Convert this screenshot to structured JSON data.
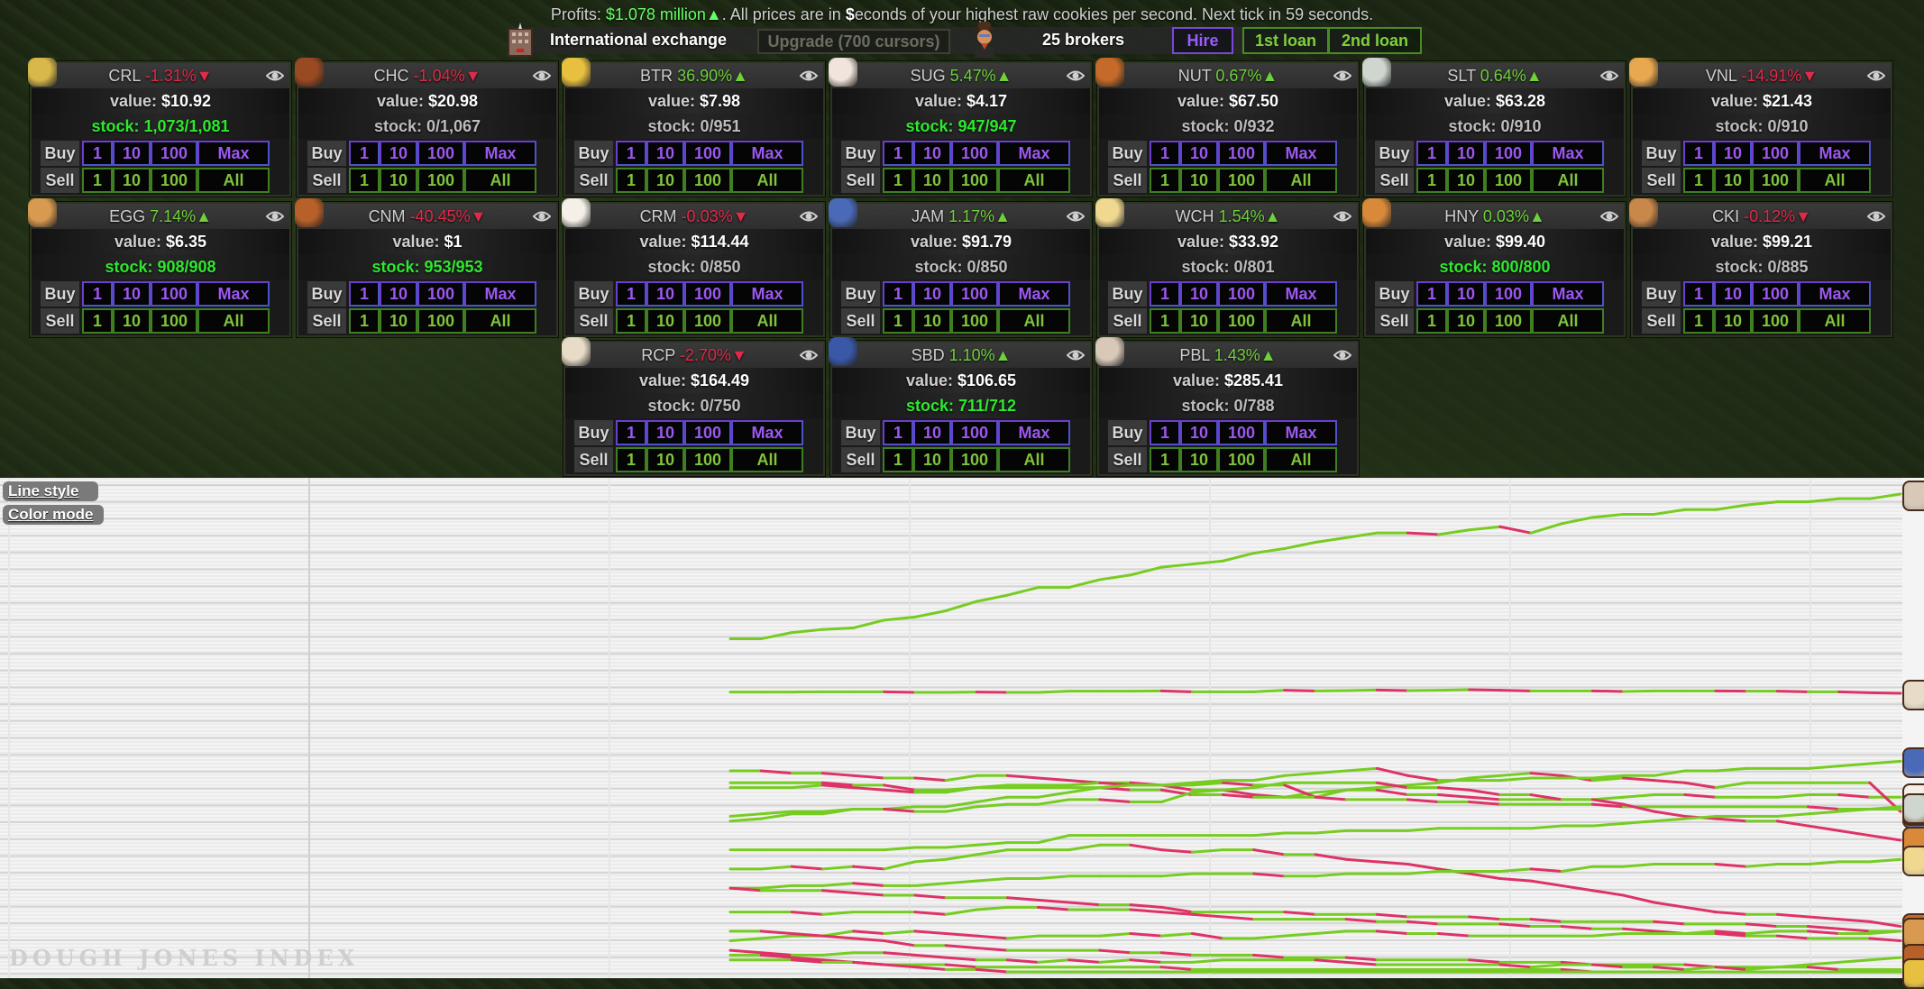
{
  "header": {
    "profits_prefix": "Profits: ",
    "profits_value": "$1.078 million▲",
    "profits_suffix_1": ". All prices are in ",
    "dollar_sign": "$",
    "profits_suffix_2": "econds of your highest raw cookies per second. Next tick in 59 seconds.",
    "exchange_name": "International exchange",
    "upgrade_label": "Upgrade (700 cursors)",
    "brokers_label": "25 brokers",
    "hire_label": "Hire",
    "loan1_label": "1st loan",
    "loan2_label": "2nd loan",
    "icons": {
      "exchange": "office-building-icon",
      "broker": "broker-icon"
    }
  },
  "labels": {
    "value_prefix": "value: ",
    "stock_prefix": "stock: ",
    "buy": "Buy",
    "sell": "Sell",
    "q1": "1",
    "q10": "10",
    "q100": "100",
    "max": "Max",
    "all": "All"
  },
  "goods": [
    {
      "symbol": "CRL",
      "change": "-1.31%▼",
      "dir": "down",
      "value": "$10.92",
      "stock": "1,073/1,081",
      "full": true,
      "icon": "cereals-icon",
      "color": "#d8b84a"
    },
    {
      "symbol": "CHC",
      "change": "-1.04%▼",
      "dir": "down",
      "value": "$20.98",
      "stock": "0/1,067",
      "full": false,
      "icon": "chocolate-icon",
      "color": "#9a4a22"
    },
    {
      "symbol": "BTR",
      "change": "36.90%▲",
      "dir": "up",
      "value": "$7.98",
      "stock": "0/951",
      "full": false,
      "icon": "butter-icon",
      "color": "#e8c040"
    },
    {
      "symbol": "SUG",
      "change": "5.47%▲",
      "dir": "up",
      "value": "$4.17",
      "stock": "947/947",
      "full": true,
      "icon": "sugar-icon",
      "color": "#f0e4dc"
    },
    {
      "symbol": "NUT",
      "change": "0.67%▲",
      "dir": "up",
      "value": "$67.50",
      "stock": "0/932",
      "full": false,
      "icon": "nuts-icon",
      "color": "#c46a2a"
    },
    {
      "symbol": "SLT",
      "change": "0.64%▲",
      "dir": "up",
      "value": "$63.28",
      "stock": "0/910",
      "full": false,
      "icon": "salt-icon",
      "color": "#cfd6cf"
    },
    {
      "symbol": "VNL",
      "change": "-14.91%▼",
      "dir": "down",
      "value": "$21.43",
      "stock": "0/910",
      "full": false,
      "icon": "vanilla-icon",
      "color": "#e8a850"
    },
    {
      "symbol": "EGG",
      "change": "7.14%▲",
      "dir": "up",
      "value": "$6.35",
      "stock": "908/908",
      "full": true,
      "icon": "eggs-icon",
      "color": "#d89a50"
    },
    {
      "symbol": "CNM",
      "change": "-40.45%▼",
      "dir": "down",
      "value": "$1",
      "stock": "953/953",
      "full": true,
      "icon": "cinnamon-icon",
      "color": "#b8602a"
    },
    {
      "symbol": "CRM",
      "change": "-0.03%▼",
      "dir": "down",
      "value": "$114.44",
      "stock": "0/850",
      "full": false,
      "icon": "cream-icon",
      "color": "#f4f0e8"
    },
    {
      "symbol": "JAM",
      "change": "1.17%▲",
      "dir": "up",
      "value": "$91.79",
      "stock": "0/850",
      "full": false,
      "icon": "jam-icon",
      "color": "#4a6ab8"
    },
    {
      "symbol": "WCH",
      "change": "1.54%▲",
      "dir": "up",
      "value": "$33.92",
      "stock": "0/801",
      "full": false,
      "icon": "white-chocolate-icon",
      "color": "#f0d890"
    },
    {
      "symbol": "HNY",
      "change": "0.03%▲",
      "dir": "up",
      "value": "$99.40",
      "stock": "800/800",
      "full": true,
      "icon": "honey-icon",
      "color": "#d88a3a"
    },
    {
      "symbol": "CKI",
      "change": "-0.12%▼",
      "dir": "down",
      "value": "$99.21",
      "stock": "0/885",
      "full": false,
      "icon": "cookies-icon",
      "color": "#c8884a"
    },
    {
      "symbol": "RCP",
      "change": "-2.70%▼",
      "dir": "down",
      "value": "$164.49",
      "stock": "0/750",
      "full": false,
      "icon": "recipes-icon",
      "color": "#e8dcc8"
    },
    {
      "symbol": "SBD",
      "change": "1.10%▲",
      "dir": "up",
      "value": "$106.65",
      "stock": "711/712",
      "full": true,
      "icon": "subsidiaries-icon",
      "color": "#3a58a8"
    },
    {
      "symbol": "PBL",
      "change": "1.43%▲",
      "dir": "up",
      "value": "$285.41",
      "stock": "0/788",
      "full": false,
      "icon": "public-relations-icon",
      "color": "#d8c8b8"
    }
  ],
  "chart_controls": {
    "line_style": "Line style",
    "color_mode": "Color mode"
  },
  "chart_data": {
    "type": "line",
    "title": "DOUGH JONES INDEX",
    "xlabel": "",
    "ylabel": "",
    "x_ticks": 27,
    "ylim": [
      0,
      300
    ],
    "grid": true,
    "legend": "icons at right end of each line",
    "up_color": "#77cc22",
    "down_color": "#dd3366",
    "series": [
      {
        "name": "PBL",
        "values": [
          232,
          232,
          236,
          238,
          239,
          244,
          246,
          250,
          256,
          260,
          265,
          265,
          270,
          273,
          278,
          280,
          282,
          287,
          290,
          294,
          297,
          300,
          300,
          299,
          302,
          304,
          300,
          306,
          310,
          312,
          312,
          315,
          315,
          318,
          320,
          320,
          322,
          322,
          325
        ]
      },
      {
        "name": "RCP",
        "values": [
          162,
          162,
          162,
          163,
          163,
          163,
          161,
          161,
          162,
          161,
          161,
          165,
          165,
          165,
          166,
          163,
          163,
          163,
          168,
          166,
          167,
          169,
          167,
          168,
          170,
          168,
          166,
          166,
          166,
          164,
          166,
          166,
          166,
          165,
          165,
          163,
          163,
          160,
          158
        ]
      },
      {
        "name": "CRM",
        "values": [
          125,
          125,
          124,
          124,
          123,
          122,
          122,
          121,
          123,
          123,
          122,
          121,
          120,
          120,
          119,
          117,
          117,
          115,
          114,
          116,
          117,
          117,
          115,
          115,
          114,
          113,
          113,
          113,
          113,
          114,
          115,
          115,
          114,
          114,
          114,
          115,
          115,
          114,
          114
        ]
      },
      {
        "name": "SBD",
        "values": [
          118,
          118,
          118,
          119,
          118,
          117,
          116,
          116,
          118,
          119,
          119,
          119,
          120,
          119,
          119,
          119,
          120,
          119,
          119,
          114,
          117,
          118,
          119,
          120,
          122,
          123,
          124,
          123,
          121,
          122,
          121,
          120,
          118,
          120,
          120,
          120,
          120,
          120,
          108
        ]
      },
      {
        "name": "CKI",
        "values": [
          120,
          120,
          120,
          120,
          119,
          119,
          117,
          117,
          118,
          118,
          118,
          118,
          118,
          117,
          117,
          115,
          115,
          114,
          114,
          114,
          113,
          113,
          113,
          112,
          112,
          111,
          111,
          111,
          111,
          110,
          110,
          110,
          110,
          110,
          110,
          110,
          109,
          109,
          109
        ]
      },
      {
        "name": "JAM",
        "values": [
          106,
          107,
          108,
          108,
          109,
          109,
          110,
          110,
          112,
          114,
          114,
          116,
          118,
          119,
          119,
          120,
          121,
          121,
          123,
          124,
          125,
          126,
          123,
          121,
          121,
          121,
          122,
          122,
          122,
          123,
          123,
          125,
          125,
          126,
          126,
          126,
          127,
          128,
          129
        ]
      },
      {
        "name": "HNY",
        "values": [
          104,
          105,
          107,
          107,
          109,
          109,
          108,
          108,
          110,
          111,
          111,
          113,
          113,
          112,
          112,
          116,
          117,
          118,
          120,
          120,
          120,
          120,
          118,
          118,
          117,
          115,
          115,
          113,
          113,
          111,
          108,
          106,
          105,
          104,
          104,
          102,
          100,
          98,
          96
        ]
      },
      {
        "name": "SLT",
        "values": [
          92,
          92,
          92,
          92,
          92,
          92,
          93,
          93,
          94,
          95,
          95,
          98,
          98,
          98,
          98,
          98,
          98,
          98,
          99,
          99,
          100,
          100,
          100,
          101,
          101,
          101,
          101,
          102,
          102,
          103,
          104,
          105,
          106,
          106,
          106,
          107,
          108,
          109,
          110
        ]
      },
      {
        "name": "NUT",
        "values": [
          84,
          84,
          85,
          84,
          85,
          84,
          87,
          88,
          90,
          92,
          92,
          92,
          94,
          94,
          92,
          91,
          92,
          92,
          90,
          90,
          88,
          87,
          86,
          84,
          82,
          80,
          79,
          77,
          75,
          73,
          70,
          68,
          66,
          65,
          65,
          64,
          63,
          62,
          60
        ]
      },
      {
        "name": "WCH",
        "values": [
          76,
          76,
          77,
          77,
          78,
          77,
          77,
          78,
          79,
          80,
          80,
          81,
          81,
          81,
          81,
          82,
          82,
          82,
          81,
          81,
          82,
          82,
          82,
          83,
          83,
          83,
          84,
          83,
          85,
          85,
          86,
          86,
          86,
          85,
          86,
          86,
          87,
          87,
          88
        ]
      },
      {
        "name": "VNL",
        "values": [
          76,
          75,
          75,
          75,
          74,
          73,
          73,
          72,
          72,
          72,
          71,
          70,
          69,
          69,
          68,
          66,
          66,
          66,
          66,
          65,
          65,
          65,
          64,
          64,
          64,
          63,
          63,
          62,
          62,
          62,
          62,
          61,
          61,
          61,
          60,
          60,
          59,
          58,
          58
        ]
      },
      {
        "name": "CRL",
        "values": [
          66,
          66,
          66,
          65,
          66,
          66,
          66,
          65,
          67,
          68,
          68,
          67,
          67,
          67,
          66,
          65,
          64,
          63,
          63,
          63,
          63,
          62,
          62,
          61,
          61,
          61,
          60,
          60,
          59,
          59,
          58,
          57,
          57,
          56,
          56,
          55,
          55,
          55,
          54
        ]
      },
      {
        "name": "EGG",
        "values": [
          54,
          55,
          56,
          56,
          58,
          57,
          58,
          57,
          56,
          55,
          56,
          56,
          56,
          57,
          56,
          57,
          55,
          55,
          56,
          57,
          58,
          58,
          57,
          57,
          56,
          56,
          56,
          56,
          56,
          57,
          57,
          57,
          58,
          57,
          58,
          58,
          57,
          57,
          58
        ]
      },
      {
        "name": "CHC",
        "values": [
          58,
          58,
          57,
          56,
          55,
          54,
          52,
          52,
          51,
          50,
          50,
          50,
          50,
          49,
          49,
          48,
          48,
          48,
          47,
          47,
          47,
          46,
          46,
          46,
          46,
          45,
          45,
          45,
          44,
          44,
          44,
          44,
          43,
          43,
          43,
          43,
          42,
          42,
          42
        ]
      },
      {
        "name": "CNM",
        "values": [
          50,
          49,
          48,
          48,
          49,
          49,
          48,
          47,
          46,
          46,
          45,
          46,
          45,
          46,
          45,
          45,
          46,
          46,
          46,
          46,
          45,
          44,
          44,
          44,
          44,
          44,
          43,
          44,
          44,
          43,
          43,
          42,
          43,
          42,
          43,
          44,
          45,
          46,
          47
        ]
      },
      {
        "name": "SUG",
        "values": [
          48,
          48,
          47,
          46,
          45,
          44,
          44,
          44,
          43,
          43,
          43,
          43,
          43,
          43,
          43,
          42,
          42,
          42,
          42,
          42,
          42,
          42,
          42,
          42,
          42,
          42,
          42,
          42,
          41,
          41,
          41,
          41,
          41,
          41,
          41,
          41,
          41,
          41,
          41
        ]
      },
      {
        "name": "BTR",
        "values": [
          46,
          46,
          46,
          45,
          45,
          44,
          43,
          42,
          42,
          41,
          41,
          41,
          41,
          41,
          41,
          41,
          41,
          41,
          41,
          41,
          41,
          41,
          41,
          41,
          41,
          41,
          41,
          41,
          41,
          41,
          41,
          41,
          41,
          41,
          41,
          41,
          41,
          41,
          41
        ]
      }
    ]
  }
}
